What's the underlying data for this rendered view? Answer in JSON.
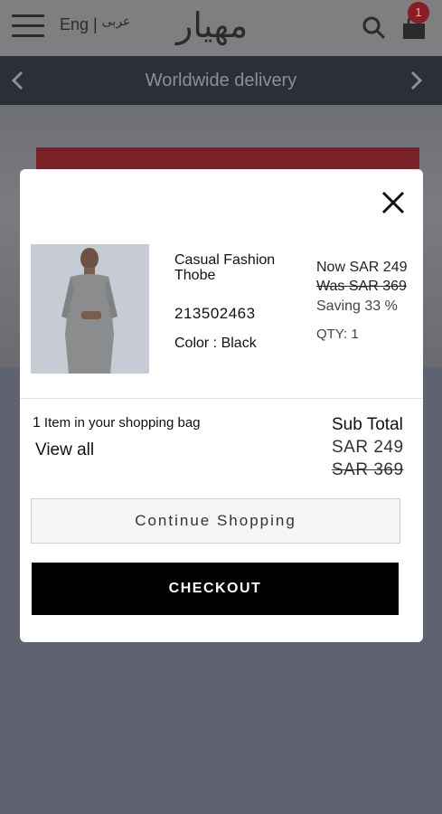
{
  "header": {
    "lang_en": "Eng",
    "lang_sep": "|",
    "lang_ar": "عربى",
    "logo_text": "مهيار",
    "cart_count": "1"
  },
  "delivery_bar": {
    "text": "Worldwide delivery"
  },
  "modal": {
    "product": {
      "name": "Casual Fashion Thobe",
      "sku": "213502463",
      "color_label": "Color :",
      "color_value": "Black",
      "price_now": "Now SAR 249",
      "price_was": "Was SAR 369",
      "saving": "Saving 33 %",
      "qty": "QTY: 1"
    },
    "bag": {
      "count": "1",
      "count_text": "Item in your shopping bag",
      "view_all": "View all",
      "subtotal_label": "Sub Total",
      "subtotal_now": "SAR  249",
      "subtotal_was": "SAR  369"
    },
    "buttons": {
      "continue": "Continue Shopping",
      "checkout": "CHECKOUT"
    }
  },
  "colors": {
    "overlay_bg": "#5f6370",
    "delivery_bar_bg": "#2a2f38",
    "checkout_bg": "#000000",
    "badge_bg": "#8a1c24"
  }
}
